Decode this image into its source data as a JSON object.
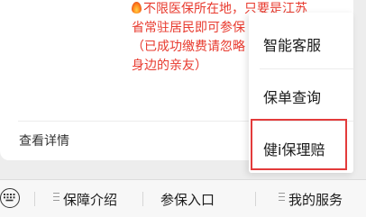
{
  "message": {
    "lines": [
      "不限医保所在地，只要是江苏",
      "省常驻居民即可参保",
      "（已成功缴费请忽略",
      "身边的亲友）"
    ],
    "detail_link": "查看详情",
    "text_color": "#e83a2e"
  },
  "popup_menu": {
    "items": [
      {
        "label": "智能客服"
      },
      {
        "label": "保单查询"
      },
      {
        "label": "健i保理赔"
      }
    ],
    "highlighted_index": 2,
    "highlight_color": "#e33b3b"
  },
  "menu_bar": {
    "keyboard_icon": "keyboard-icon",
    "items": [
      {
        "label": "保障介绍",
        "has_submenu": true
      },
      {
        "label": "参保入口",
        "has_submenu": false
      },
      {
        "label": "我的服务",
        "has_submenu": true
      }
    ]
  }
}
